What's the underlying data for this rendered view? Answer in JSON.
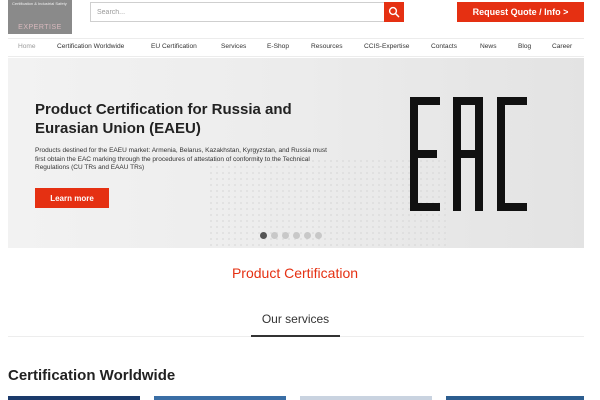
{
  "header": {
    "logo_text": "EXPERTISE",
    "logo_small_text": "Certification & Industrial Safety",
    "search_placeholder": "Search...",
    "quote_button": "Request Quote / Info >",
    "colors": {
      "accent": "#e53012",
      "logo_bg": "#8a8a8a"
    }
  },
  "nav": {
    "items": [
      {
        "label": "Home"
      },
      {
        "label": "Certification Worldwide"
      },
      {
        "label": "EU Certification"
      },
      {
        "label": "Services"
      },
      {
        "label": "E-Shop"
      },
      {
        "label": "Resources"
      },
      {
        "label": "CCIS-Expertise"
      },
      {
        "label": "Contacts"
      },
      {
        "label": "News"
      },
      {
        "label": "Blog"
      },
      {
        "label": "Career"
      }
    ],
    "active": "Home"
  },
  "hero": {
    "title": "Product Certification for Russia and Eurasian Union (EAEU)",
    "description": "Products destined for the EAEU market: Armenia, Belarus, Kazakhstan, Kyrgyzstan, and Russia must first obtain the EAC marking through the procedures of attestation of conformity to the Technical Regulations (CU TRs and EAAU TRs)",
    "button": "Learn more",
    "logo_mark": "EAC",
    "slides_total": 6,
    "slide_active": 1
  },
  "main": {
    "product_certification": "Product Certification",
    "services_tab": "Our services",
    "section_title": "Certification Worldwide",
    "card_colors": [
      "#1b3a6b",
      "#3a6ea5",
      "#c9d3e0",
      "#2c5d8f"
    ]
  }
}
